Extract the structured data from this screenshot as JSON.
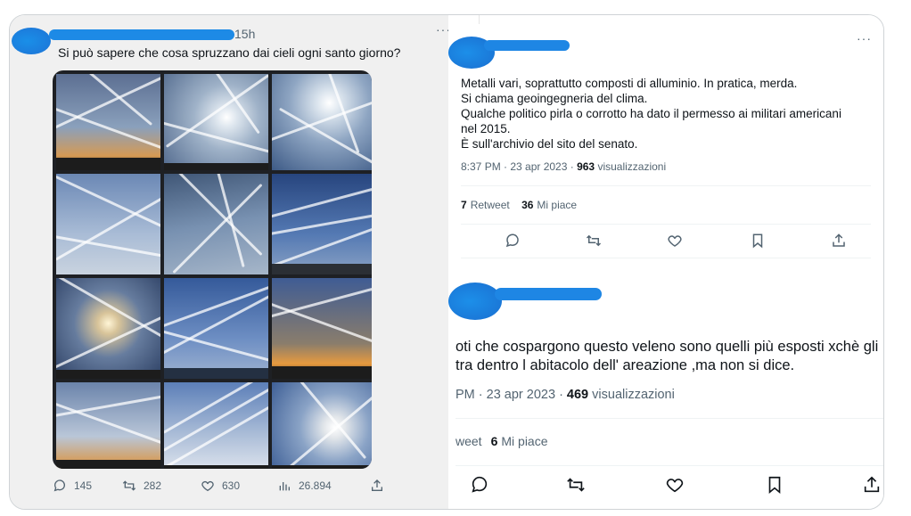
{
  "left_tweet": {
    "time": "15h",
    "text": "Si può sapere che cosa spruzzano dai cieli ogni santo giorno?",
    "more": "···",
    "stats": {
      "replies": "145",
      "retweets": "282",
      "likes": "630",
      "views": "26.894"
    }
  },
  "reply1": {
    "more": "···",
    "lines": [
      "Metalli vari, soprattutto composti di alluminio. In pratica, merda.",
      "Si chiama geoingegneria del clima.",
      "Qualche politico pirla o corrotto ha dato il permesso ai militari americani",
      "nel 2015.",
      "È sull'archivio del sito del senato."
    ],
    "meta_time": "8:37 PM · 23 apr 2023 · ",
    "meta_views": "963",
    "meta_views_label": " visualizzazioni",
    "retweets_count": "7",
    "retweets_label": "Retweet",
    "likes_count": "36",
    "likes_label": "Mi piace"
  },
  "reply2": {
    "lines": [
      "oti che cospargono questo veleno sono quelli più esposti xchè gli",
      "tra dentro l abitacolo dell' areazione ,ma non si dice."
    ],
    "meta_time": "PM · 23 apr 2023 · ",
    "meta_views": "469",
    "meta_views_label": " visualizzazioni",
    "retweets_label": "weet",
    "likes_count": "6",
    "likes_label": "Mi piace"
  },
  "icons": [
    "reply-icon",
    "retweet-icon",
    "like-icon",
    "views-icon",
    "bookmark-icon",
    "share-icon"
  ],
  "colors": {
    "redaction": "#1d8ae6",
    "muted": "#536471",
    "text": "#0f1419"
  }
}
